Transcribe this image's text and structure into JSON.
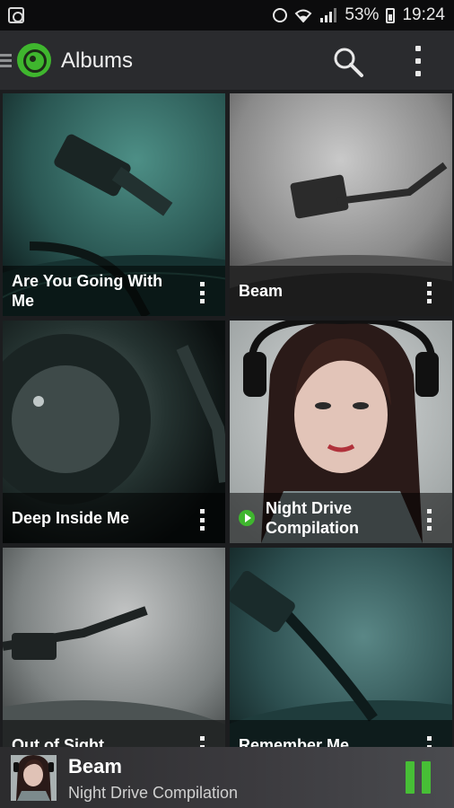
{
  "status_bar": {
    "battery": "53%",
    "time": "19:24"
  },
  "app_bar": {
    "title": "Albums"
  },
  "albums": [
    {
      "title": "Are You Going With Me",
      "playing": false
    },
    {
      "title": "Beam",
      "playing": false
    },
    {
      "title": "Deep Inside Me",
      "playing": false
    },
    {
      "title": "Night Drive Compilation",
      "playing": true
    },
    {
      "title": "Out of Sight",
      "playing": false
    },
    {
      "title": "Remember Me",
      "playing": false
    }
  ],
  "now_playing": {
    "track": "Beam",
    "album": "Night Drive Compilation",
    "state": "playing"
  },
  "colors": {
    "accent": "#3fb62e",
    "appbar": "#2a2b2e",
    "background": "#1c1d1f"
  }
}
